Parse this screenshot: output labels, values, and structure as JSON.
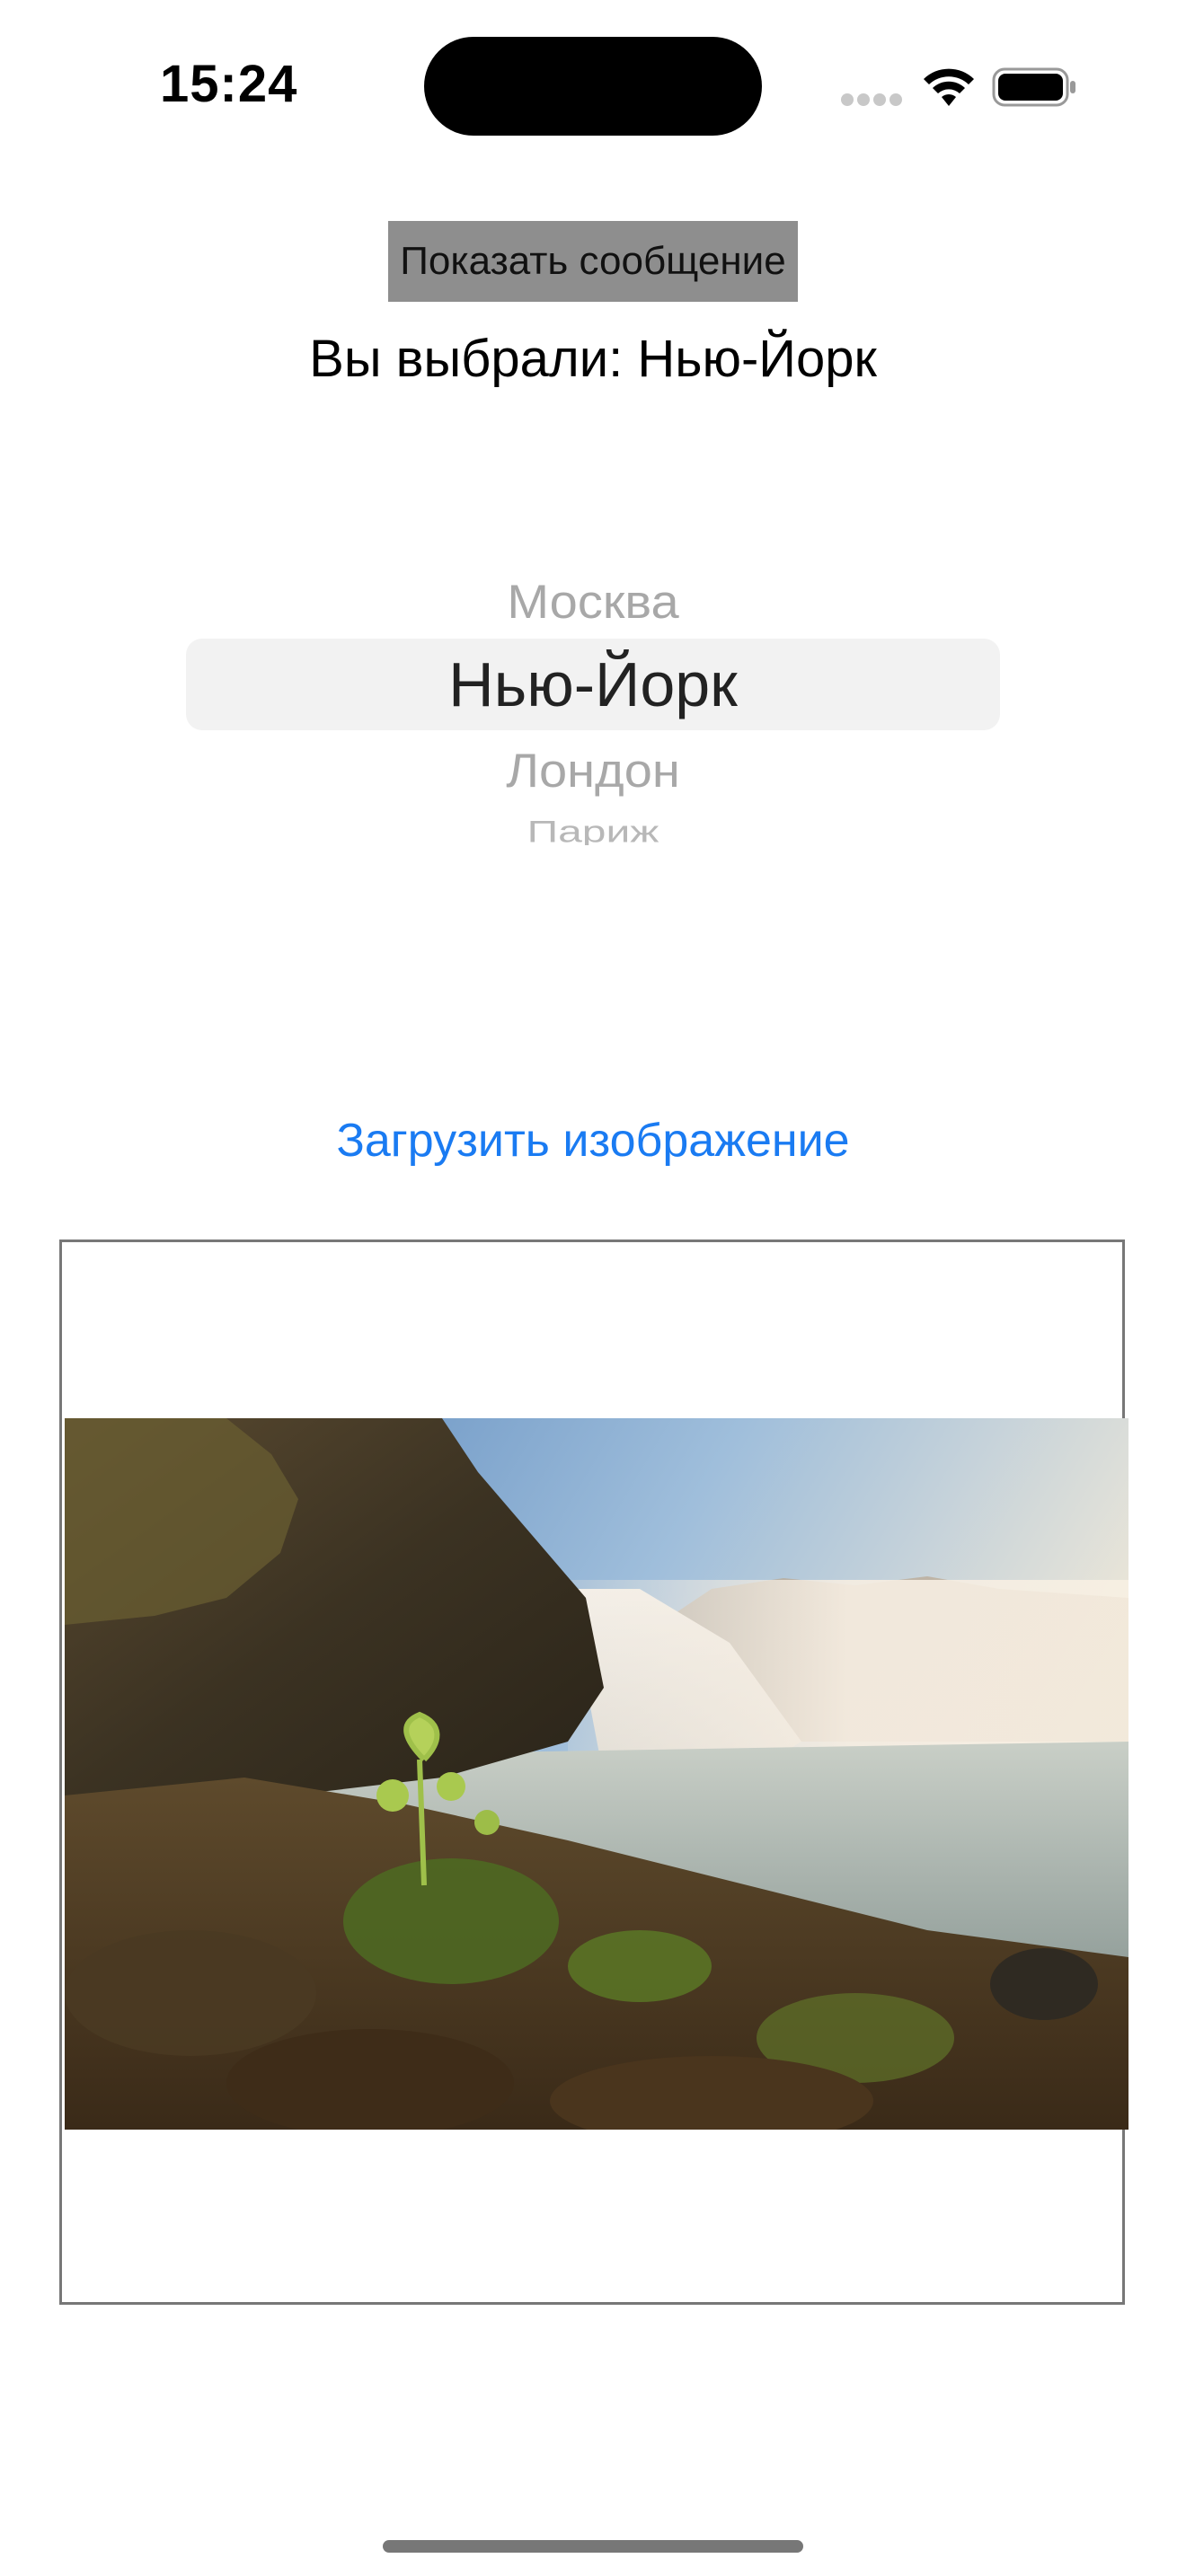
{
  "status_bar": {
    "time": "15:24",
    "icons": [
      "cellular-signal-icon",
      "wifi-icon",
      "battery-icon"
    ]
  },
  "main": {
    "show_message_label": "Показать сообщение",
    "selection_text": "Вы выбрали: Нью-Йорк",
    "picker": {
      "options": [
        "Москва",
        "Нью-Йорк",
        "Лондон",
        "Париж"
      ],
      "selected": "Нью-Йорк"
    },
    "load_image_label": "Загрузить изображение",
    "image": {
      "content": "waterfall-landscape-photo"
    }
  },
  "colors": {
    "accent": "#1a7bf2",
    "button_bg": "#8e8e8e",
    "picker_highlight": "#f2f2f2"
  }
}
